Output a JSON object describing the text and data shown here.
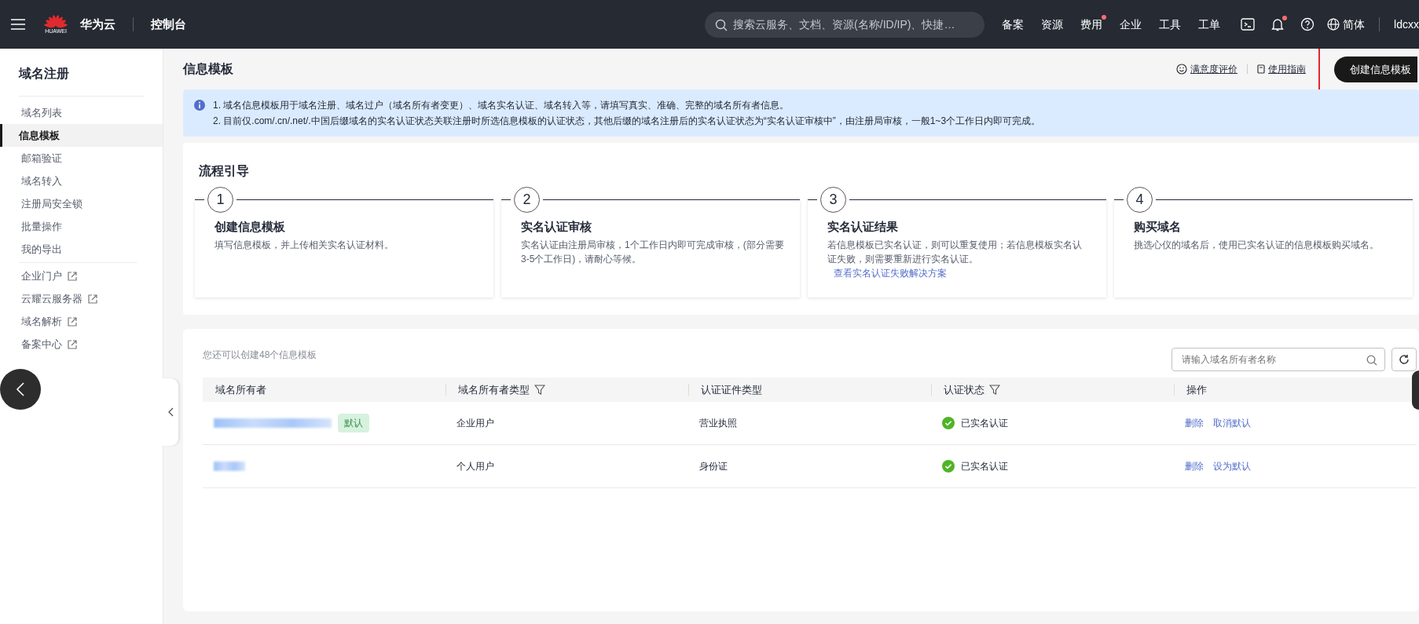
{
  "topbar": {
    "logo_text": "HUAWEI",
    "brand": "华为云",
    "console": "控制台",
    "search_placeholder": "搜索云服务、文档、资源(名称/ID/IP)、快捷…",
    "nav": [
      {
        "label": "备案",
        "dot": false
      },
      {
        "label": "资源",
        "dot": false
      },
      {
        "label": "费用",
        "dot": true
      },
      {
        "label": "企业",
        "dot": false
      },
      {
        "label": "工具",
        "dot": false
      },
      {
        "label": "工单",
        "dot": false
      }
    ],
    "icons": [
      {
        "kind": "terminal",
        "dot": false
      },
      {
        "kind": "bell",
        "dot": true
      },
      {
        "kind": "help",
        "dot": false
      }
    ],
    "language": "简体",
    "user": "ldcxx"
  },
  "sidebar": {
    "title": "域名注册",
    "items": [
      {
        "label": "域名列表",
        "selected": false,
        "external": false
      },
      {
        "label": "信息模板",
        "selected": true,
        "external": false
      },
      {
        "label": "邮箱验证",
        "selected": false,
        "external": false
      },
      {
        "label": "域名转入",
        "selected": false,
        "external": false
      },
      {
        "label": "注册局安全锁",
        "selected": false,
        "external": false
      },
      {
        "label": "批量操作",
        "selected": false,
        "external": false
      },
      {
        "label": "我的导出",
        "selected": false,
        "external": false
      },
      {
        "label": "企业门户",
        "selected": false,
        "external": true
      },
      {
        "label": "云耀云服务器",
        "selected": false,
        "external": true
      },
      {
        "label": "域名解析",
        "selected": false,
        "external": true
      },
      {
        "label": "备案中心",
        "selected": false,
        "external": true
      }
    ]
  },
  "page": {
    "title": "信息模板",
    "feedback": "满意度评价",
    "guide": "使用指南",
    "create_button": "创建信息模板",
    "highlighted": true
  },
  "notice": [
    "1. 域名信息模板用于域名注册、域名过户（域名所有者变更）、域名实名认证、域名转入等，请填写真实、准确、完整的域名所有者信息。",
    "2. 目前仅.com/.cn/.net/.中国后缀域名的实名认证状态关联注册时所选信息模板的认证状态，其他后缀的域名注册后的实名认证状态为“实名认证审核中”，由注册局审核，一般1~3个工作日内即可完成。"
  ],
  "flow": {
    "title": "流程引导",
    "steps": [
      {
        "number": "1",
        "title": "创建信息模板",
        "desc": "填写信息模板，并上传相关实名认证材料。"
      },
      {
        "number": "2",
        "title": "实名认证审核",
        "desc": "实名认证由注册局审核，1个工作日内即可完成审核，(部分需要3-5个工作日)，请耐心等候。"
      },
      {
        "number": "3",
        "title": "实名认证结果",
        "desc": "若信息模板已实名认证，则可以重复使用；若信息模板实名认证失败，则需要重新进行实名认证。",
        "link": "查看实名认证失败解决方案"
      },
      {
        "number": "4",
        "title": "购买域名",
        "desc": "挑选心仪的域名后，使用已实名认证的信息模板购买域名。"
      }
    ]
  },
  "templates": {
    "quota": "您还可以创建48个信息模板",
    "search_placeholder": "请输入域名所有者名称",
    "columns": [
      {
        "label": "域名所有者",
        "filter": false
      },
      {
        "label": "域名所有者类型",
        "filter": true
      },
      {
        "label": "认证证件类型",
        "filter": false
      },
      {
        "label": "认证状态",
        "filter": true
      },
      {
        "label": "操作",
        "filter": false
      }
    ],
    "rows": [
      {
        "badge": "默认",
        "type": "企业用户",
        "cert": "营业执照",
        "status": "已实名认证",
        "verified": true,
        "actions": [
          "删除",
          "取消默认"
        ]
      },
      {
        "type": "个人用户",
        "cert": "身份证",
        "status": "已实名认证",
        "verified": true,
        "actions": [
          "删除",
          "设为默认"
        ]
      }
    ]
  }
}
